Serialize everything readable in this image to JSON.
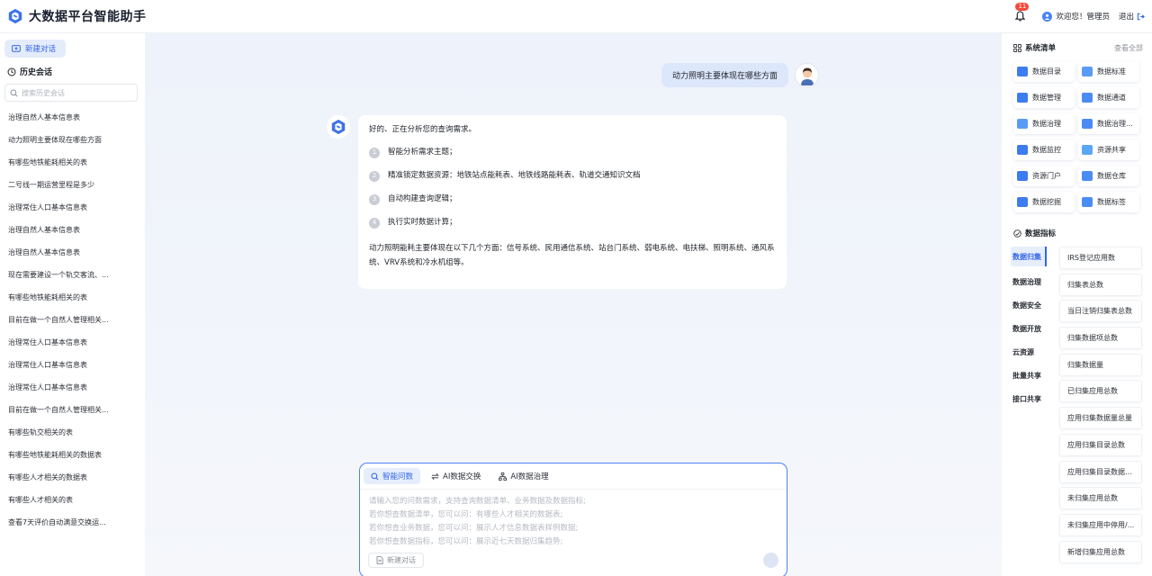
{
  "header": {
    "app_title": "大数据平台智能助手",
    "notification_count": "11",
    "welcome": "欢迎您！管理员",
    "logout": "退出"
  },
  "sidebar": {
    "new_chat": "新建对话",
    "history_title": "历史会话",
    "search_placeholder": "搜索历史会话",
    "items": [
      "治理自然人基本信息表",
      "动力照明主要体现在哪些方面",
      "有哪些地铁能耗相关的表",
      "二号线一期运营里程是多少",
      "治理常住人口基本信息表",
      "治理自然人基本信息表",
      "治理自然人基本信息表",
      "现在需要建设一个轨交客流、...",
      "有哪些地铁能耗相关的表",
      "目前在做一个自然人管理相关...",
      "治理常住人口基本信息表",
      "治理常住人口基本信息表",
      "治理常住人口基本信息表",
      "目前在做一个自然人管理相关...",
      "有哪些轨交相关的表",
      "有哪些地铁能耗相关的数据表",
      "有哪些人才相关的数据表",
      "有哪些人才相关的表",
      "查看7天评价自动满意交换运..."
    ]
  },
  "chat": {
    "user_message": "动力照明主要体现在哪些方面",
    "bot_intro": "好的、正在分析您的查询需求。",
    "steps": [
      {
        "num": "1",
        "text": "智能分析需求主题；"
      },
      {
        "num": "2",
        "text": "精准锁定数据资源：地铁站点能耗表、地铁线路能耗表、轨道交通知识文档"
      },
      {
        "num": "3",
        "text": "自动构建查询逻辑；"
      },
      {
        "num": "4",
        "text": "执行实时数据计算；"
      }
    ],
    "bot_answer": "动力照明能耗主要体现在以下几个方面：信号系统、民用通信系统、站台门系统、弱电系统、电扶梯、照明系统、通风系统、VRV系统和冷水机组等。"
  },
  "input": {
    "tabs": [
      {
        "label": "智能问数",
        "icon": "search-icon"
      },
      {
        "label": "AI数据交换",
        "icon": "exchange-icon"
      },
      {
        "label": "AI数据治理",
        "icon": "hierarchy-icon"
      }
    ],
    "placeholder_lines": "请输入您的问数需求，支持查询数据清单、业务数据及数据指标;\n若你想查数据清单，您可以问：有哪些人才相关的数据表;\n若你想查业务数据，您可以问：展示人才信息数据表样例数据;\n若你想查数据指标，您可以问：展示近七天数据归集趋势;",
    "new_chat": "新建对话"
  },
  "right_panel": {
    "system_list_title": "系统清单",
    "view_all": "查看全部",
    "systems": [
      {
        "label": "数据目录",
        "color": "#3d7bf0"
      },
      {
        "label": "数据标准",
        "color": "#5a9cf5"
      },
      {
        "label": "数据管理",
        "color": "#3d7bf0"
      },
      {
        "label": "数据通道",
        "color": "#4a8cf4"
      },
      {
        "label": "数据治理",
        "color": "#5a9cf5"
      },
      {
        "label": "数据治理...",
        "color": "#4a8cf4"
      },
      {
        "label": "数据监控",
        "color": "#3d7bf0"
      },
      {
        "label": "资源共享",
        "color": "#5aa8f5"
      },
      {
        "label": "资源门户",
        "color": "#3d7bf0"
      },
      {
        "label": "数据仓库",
        "color": "#4a8cf4"
      },
      {
        "label": "数据挖掘",
        "color": "#3d7bf0"
      },
      {
        "label": "数据标签",
        "color": "#4a8cf4"
      }
    ],
    "metrics_title": "数据指标",
    "metric_categories": [
      "数据归集",
      "数据治理",
      "数据安全",
      "数据开放",
      "云资源",
      "批量共享",
      "接口共享"
    ],
    "metric_items": [
      "IRS登记应用数",
      "归集表总数",
      "当日注销归集表总数",
      "归集数据项总数",
      "归集数据量",
      "已归集应用总数",
      "应用归集数据量总量",
      "应用归集目录总数",
      "应用归集目录数据...",
      "未归集应用总数",
      "未归集应用中停用/...",
      "新增归集应用总数"
    ]
  }
}
